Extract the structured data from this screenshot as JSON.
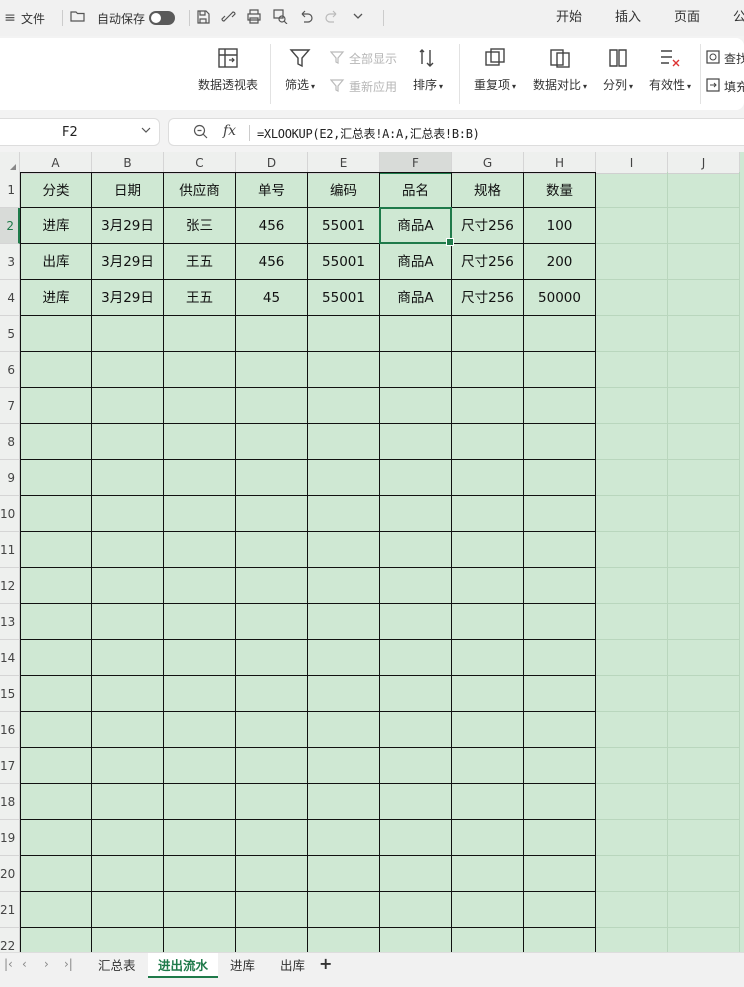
{
  "menubar": {
    "menu_icon": "≡",
    "file_label": "文件",
    "autosave_label": "自动保存",
    "tabs": [
      "开始",
      "插入",
      "页面",
      "公"
    ]
  },
  "ribbon": {
    "pivot_label": "数据透视表",
    "filter_label": "筛选",
    "show_all_label": "全部显示",
    "reapply_label": "重新应用",
    "sort_label": "排序",
    "duplicates_label": "重复项",
    "compare_label": "数据对比",
    "split_label": "分列",
    "validity_label": "有效性",
    "find_label": "查找",
    "fill_label": "填充"
  },
  "formula_bar": {
    "name_box": "F2",
    "fx_label": "fx",
    "formula": "=XLOOKUP(E2,汇总表!A:A,汇总表!B:B)"
  },
  "sheet": {
    "columns": [
      "A",
      "B",
      "C",
      "D",
      "E",
      "F",
      "G",
      "H",
      "I",
      "J"
    ],
    "rows": [
      "1",
      "2",
      "3",
      "4",
      "5",
      "6",
      "7",
      "8",
      "9",
      "10",
      "11",
      "12",
      "13",
      "14",
      "15",
      "16",
      "17",
      "18",
      "19",
      "20",
      "21",
      "22"
    ],
    "selected_cell": "F2",
    "headers": [
      "分类",
      "日期",
      "供应商",
      "单号",
      "编码",
      "品名",
      "规格",
      "数量"
    ],
    "data": [
      [
        "进库",
        "3月29日",
        "张三",
        "456",
        "55001",
        "商品A",
        "尺寸256",
        "100"
      ],
      [
        "出库",
        "3月29日",
        "王五",
        "456",
        "55001",
        "商品A",
        "尺寸256",
        "200"
      ],
      [
        "进库",
        "3月29日",
        "王五",
        "45",
        "55001",
        "商品A",
        "尺寸256",
        "50000"
      ]
    ]
  },
  "sheet_tabs": [
    "汇总表",
    "进出流水",
    "进库",
    "出库"
  ],
  "active_sheet": "进出流水",
  "add_sheet": "+",
  "accent_color": "#1f7a4a",
  "grid_color": "#cfe8d3"
}
